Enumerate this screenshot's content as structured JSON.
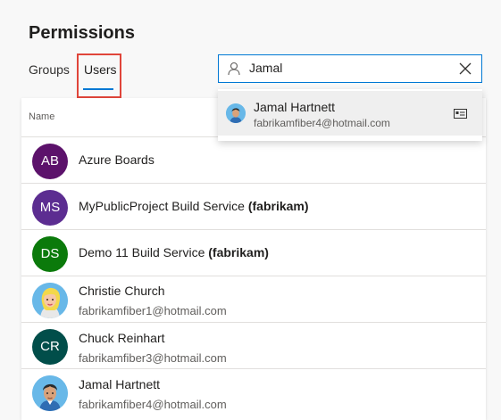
{
  "page": {
    "title": "Permissions"
  },
  "tabs": [
    {
      "label": "Groups",
      "selected": false
    },
    {
      "label": "Users",
      "selected": true
    }
  ],
  "search": {
    "value": "Jamal",
    "clear_icon": "close-icon",
    "leading_icon": "person-icon"
  },
  "suggestions": [
    {
      "name": "Jamal Hartnett",
      "email": "fabrikamfiber4@hotmail.com",
      "avatar_icon": "user-avatar",
      "action_icon": "contact-card-icon"
    }
  ],
  "table": {
    "column_header": "Name",
    "rows": [
      {
        "initials": "AB",
        "name": "Azure Boards",
        "suffix": "",
        "email": "",
        "color": "#5c126b"
      },
      {
        "initials": "MS",
        "name": "MyPublicProject Build Service",
        "suffix": "(fabrikam)",
        "email": "",
        "color": "#5c2d91"
      },
      {
        "initials": "DS",
        "name": "Demo 11 Build Service",
        "suffix": "(fabrikam)",
        "email": "",
        "color": "#0b7a0b"
      },
      {
        "initials": "",
        "name": "Christie Church",
        "suffix": "",
        "email": "fabrikamfiber1@hotmail.com",
        "color": "#68b8e8"
      },
      {
        "initials": "CR",
        "name": "Chuck Reinhart",
        "suffix": "",
        "email": "fabrikamfiber3@hotmail.com",
        "color": "#014e4a"
      },
      {
        "initials": "",
        "name": "Jamal Hartnett",
        "suffix": "",
        "email": "fabrikamfiber4@hotmail.com",
        "color": "#68b8e8"
      }
    ]
  },
  "colors": {
    "accent": "#0078d4",
    "highlight": "#e0453a"
  }
}
